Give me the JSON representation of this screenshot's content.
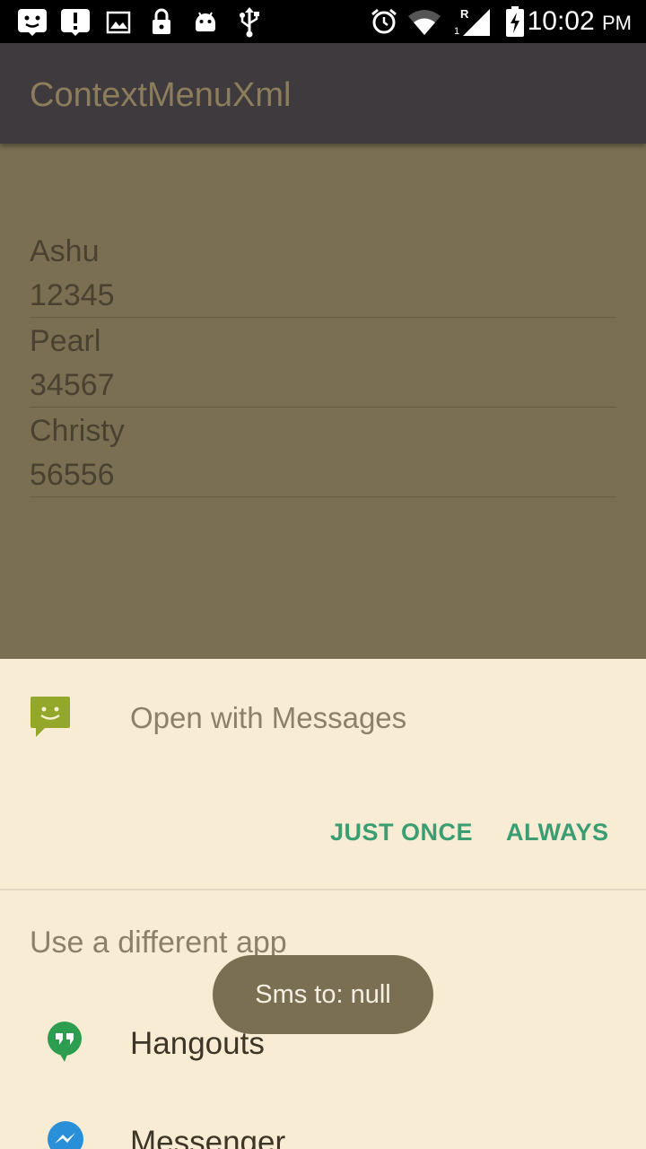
{
  "status_bar": {
    "time": "10:02",
    "ampm": "PM",
    "icons": [
      "notification-face-icon",
      "alert-icon",
      "image-icon",
      "lock-icon",
      "android-icon",
      "usb-icon",
      "alarm-icon",
      "wifi-icon",
      "signal-icon",
      "battery-charging-icon"
    ],
    "signal_labels": [
      "R",
      "1"
    ]
  },
  "app_bar": {
    "title": "ContextMenuXml"
  },
  "contacts": [
    {
      "name": "Ashu",
      "number": "12345"
    },
    {
      "name": "Pearl",
      "number": "34567"
    },
    {
      "name": "Christy",
      "number": "56556"
    }
  ],
  "chooser": {
    "open_with_label": "Open with Messages",
    "just_once_label": "JUST ONCE",
    "always_label": "ALWAYS",
    "different_app_heading": "Use a different app",
    "apps": [
      {
        "label": "Hangouts",
        "icon": "hangouts-icon"
      },
      {
        "label": "Messenger",
        "icon": "messenger-icon"
      }
    ]
  },
  "toast": {
    "text": "Sms to: null"
  },
  "colors": {
    "accent": "#3a9e72",
    "app_bar": "#3e3a3d",
    "dim_background": "#7a6f52",
    "sheet": "#f9ecd4"
  }
}
